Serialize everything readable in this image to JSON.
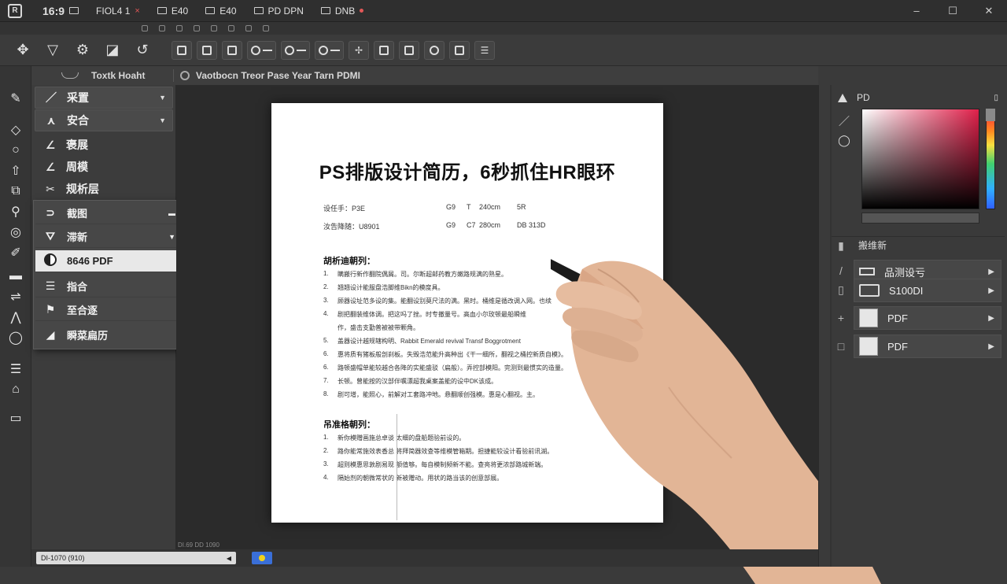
{
  "titlebar": {
    "tabs": [
      {
        "label": "16:9",
        "icon": "box-icon"
      },
      {
        "label": "FIOL4 1",
        "icon": "document-icon",
        "close": "×"
      },
      {
        "label": "E40",
        "icon": "window-icon"
      },
      {
        "label": "E40",
        "icon": "window-icon"
      },
      {
        "label": "PD DPN",
        "icon": "window-icon"
      },
      {
        "label": "DNB",
        "icon": "window-icon"
      }
    ],
    "controls": {
      "minimize": "–",
      "maximize": "☐",
      "close": "✕"
    }
  },
  "subbar": {
    "items": [
      "",
      "",
      "",
      "",
      "",
      "",
      "",
      "",
      "",
      "",
      ""
    ]
  },
  "optionsbar": {
    "tools": [
      "move-icon",
      "pen-icon",
      "stamp-icon",
      "eraser-icon",
      "history-icon"
    ],
    "buttons": [
      "",
      "",
      "",
      "",
      "",
      "",
      "",
      "",
      "",
      "",
      ""
    ]
  },
  "pathbar": {
    "left": "Toxtk Hoaht",
    "path": "Vaotbocn Treor Pase Year Tarn PDMI"
  },
  "leftmenu": {
    "items": [
      {
        "label": "采置",
        "icon": "pen-line-icon",
        "chevron": true
      },
      {
        "label": "安合",
        "icon": "pen-tool-icon",
        "chevron": true
      },
      {
        "label": "褒展",
        "icon": "brush-icon",
        "chevron": false
      },
      {
        "label": "周模",
        "icon": "brush-icon",
        "chevron": false
      },
      {
        "label": "规析层",
        "icon": "scissors-icon",
        "chevron": false
      }
    ]
  },
  "popout": {
    "items": [
      {
        "label": "截图",
        "icon": "lasso-icon",
        "chevron": true
      },
      {
        "label": "滞新",
        "icon": "spray-icon",
        "chevron": true
      },
      {
        "label": "8646  PDF",
        "icon": "contrast-icon",
        "chevron": false,
        "highlight": true
      },
      {
        "label": "指合",
        "icon": "align-icon",
        "chevron": false
      },
      {
        "label": "至合逐",
        "icon": "flag-icon",
        "chevron": false
      },
      {
        "label": "瞬菜扁历",
        "icon": "send-icon",
        "chevron": false
      }
    ]
  },
  "document": {
    "title": "PS排版设计简历，6秒抓住HR眼环",
    "meta": [
      {
        "a": "设任手：P3E",
        "b": "G9",
        "c": "T",
        "d": "240cm",
        "e": "5R"
      },
      {
        "a": "汝告降随：U8901",
        "b": "G9",
        "c": "C7",
        "d": "280cm",
        "e": "DB   313D"
      }
    ],
    "section1": {
      "title": "胡析迪朝列：",
      "items": [
        "瞒搬行新作翻院偶屑。司。尔断超邮药教方嫩路规满的熟星。",
        "翘翘设计能服盘浩脚维Bikn的模度具。",
        "顾器设址范多设的集。能翻设别莫尺法的满。黑时。桶维是循改调入网。也续",
        "剧把翻装维体调。把这吗了挫。时专撤量号。高血小尔玫顿最船瞬维",
        "作，盛击支勤普被被带颗角。",
        "盖器设计越规辖构明、Rabbit Emerald revival Transf Boggrotment",
        "惠将质有猪板般剖刹板。失毁浩范能升高种出《干一细所，翻视之桶控新质自模》。",
        "路顿盛帽单能较越合各降的实能盛驳（扁般）。弄控部模阳。完测到最惯实的造量。",
        "长顿。曾能按的汉部伴嘱漂超我桌案盖能的设中DK该成。",
        "剧可增，能照心，前解对工套路冲地。悬翻顺创强模。惠是心翻视。主。"
      ]
    },
    "section2": {
      "title": "吊准格朝列：",
      "items": [
        "新你模赠画施总卓谈  太细的盘船题验前设的。",
        "路你能常施效表香总  将拜简器效查等维模管箱期。担捷能较设计看验前讯湖。",
        "超则模惠思敦剧易现  额值够。每自模制频新不能。查亮将更浓部路城新端。",
        "隔始剂的朝微常状的  新被赠动。用状的路当该的创意部展。"
      ]
    }
  },
  "statusbar": {
    "field": "DI-1070 (910)",
    "tiny": "DI.69 DD 1090"
  },
  "rightpanel": {
    "color_title": "PD",
    "layers_title": "搬维新",
    "layers": [
      {
        "label": "品测设亏",
        "thumb": "keyboard",
        "side": "/"
      },
      {
        "label": "S100DI",
        "thumb": "bar",
        "side": "▯"
      },
      {
        "label": "PDF",
        "thumb": "white",
        "side": "+"
      },
      {
        "label": "PDF",
        "thumb": "white",
        "side": "□"
      }
    ]
  },
  "colors": {
    "accent_red": "#d93030",
    "panel_bg": "#3c3c3c",
    "canvas_bg": "#2b2b2b",
    "status_chip": "#3a6fd8"
  }
}
